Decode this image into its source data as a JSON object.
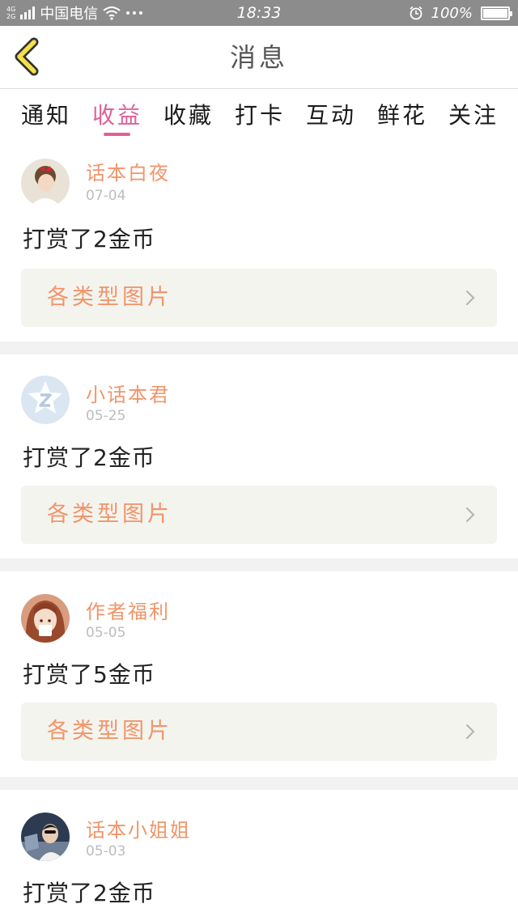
{
  "status_bar": {
    "network_top": "4G",
    "network_bottom": "2G",
    "carrier": "中国电信",
    "time": "18:33",
    "battery": "100%",
    "icons": [
      "signal-icon",
      "wifi-icon",
      "more-dots-icon",
      "alarm-icon",
      "battery-icon"
    ]
  },
  "header": {
    "title": "消息",
    "back_icon": "chevron-left-icon"
  },
  "tabs": [
    {
      "label": "通知",
      "active": false
    },
    {
      "label": "收益",
      "active": true
    },
    {
      "label": "收藏",
      "active": false
    },
    {
      "label": "打卡",
      "active": false
    },
    {
      "label": "互动",
      "active": false
    },
    {
      "label": "鲜花",
      "active": false
    },
    {
      "label": "关注",
      "active": false
    }
  ],
  "colors": {
    "accent": "#e0609a",
    "sender": "#f0956a",
    "link_bg": "#f4f4ef",
    "status_bar": "#8c8c8c"
  },
  "messages": [
    {
      "sender": "话本白夜",
      "date": "07-04",
      "text": "打赏了2金币",
      "link": "各类型图片",
      "avatar": "avatar-girl-red-bow"
    },
    {
      "sender": "小话本君",
      "date": "05-25",
      "text": "打赏了2金币",
      "link": "各类型图片",
      "avatar": "avatar-default-qq"
    },
    {
      "sender": "作者福利",
      "date": "05-05",
      "text": "打赏了5金币",
      "link": "各类型图片",
      "avatar": "avatar-anime-girl"
    },
    {
      "sender": "话本小姐姐",
      "date": "05-03",
      "text": "打赏了2金币",
      "avatar": "avatar-person-car"
    }
  ]
}
